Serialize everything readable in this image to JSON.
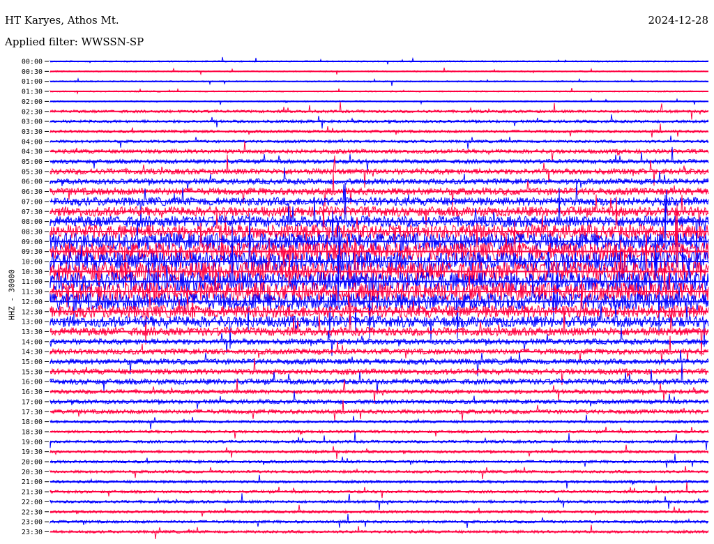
{
  "header": {
    "station": "HT Karyes, Athos Mt.",
    "filter": "Applied filter: WWSSN-SP",
    "date": "2024-12-28"
  },
  "chart_data": {
    "type": "line",
    "ylabel": "HHZ - 30000",
    "row_times": [
      "00:00",
      "00:30",
      "01:00",
      "01:30",
      "02:00",
      "02:30",
      "03:00",
      "03:30",
      "04:00",
      "04:30",
      "05:00",
      "05:30",
      "06:00",
      "06:30",
      "07:00",
      "07:30",
      "08:00",
      "08:30",
      "09:00",
      "09:30",
      "10:00",
      "10:30",
      "11:00",
      "11:30",
      "12:00",
      "12:30",
      "13:00",
      "13:30",
      "14:00",
      "14:30",
      "15:00",
      "15:30",
      "16:00",
      "16:30",
      "17:00",
      "17:30",
      "18:00",
      "18:30",
      "19:00",
      "19:30",
      "20:00",
      "20:30",
      "21:00",
      "21:30",
      "22:00",
      "22:30",
      "23:00",
      "23:30"
    ],
    "trace_colors": [
      "#0000ff",
      "#ff0040"
    ],
    "noise_level": [
      1,
      1,
      1,
      1,
      1,
      2,
      2,
      2,
      2,
      3,
      3,
      4,
      4,
      5,
      6,
      7,
      8,
      10,
      12,
      13,
      14,
      14,
      14,
      13,
      12,
      9,
      8,
      6,
      4,
      4,
      4,
      4,
      4,
      3,
      3,
      3,
      2,
      2,
      2,
      2,
      2,
      2,
      2,
      2,
      2,
      2,
      2,
      2
    ]
  }
}
